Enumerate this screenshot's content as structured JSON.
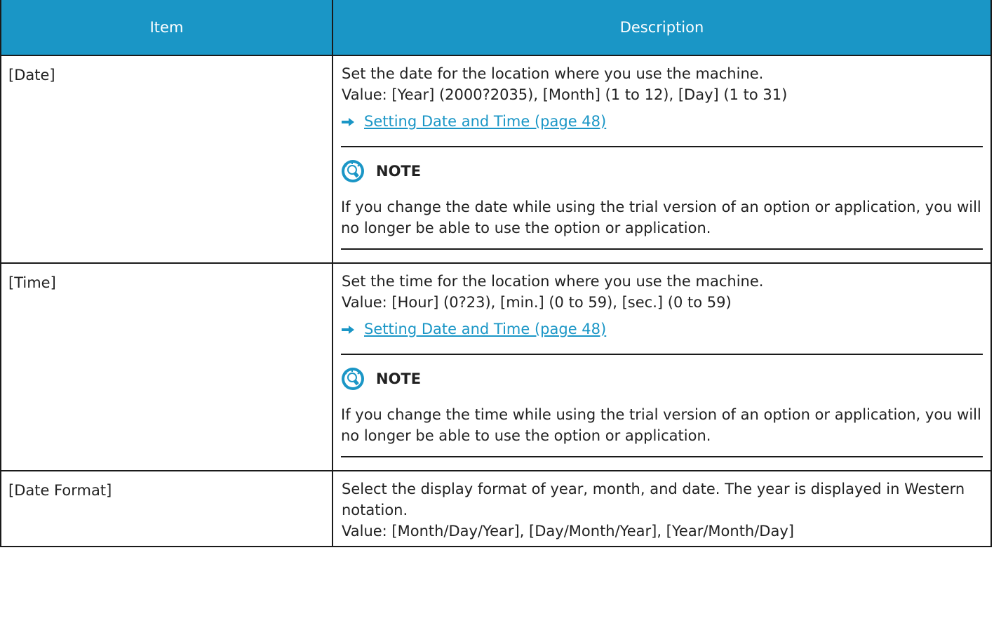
{
  "header": {
    "col_item": "Item",
    "col_desc": "Description"
  },
  "rows": [
    {
      "item": "[Date]",
      "line1": "Set the date for the location where you use the machine.",
      "line2": "Value: [Year] (2000?2035),  [Month] (1 to 12), [Day] (1 to 31)",
      "link": "Setting Date and Time (page 48)",
      "note_title": "NOTE",
      "note_body": "If you change the date while using the trial version of an option or application, you will no longer be able to use the option or application."
    },
    {
      "item": "[Time]",
      "line1": "Set the time for the location where you use the machine.",
      "line2": "Value: [Hour] (0?23),  [min.] (0 to 59), [sec.] (0 to 59)",
      "link": "Setting Date and Time (page 48)",
      "note_title": "NOTE",
      "note_body": "If you change the time while using the trial version of an option or application, you will no longer be able to use the option or application."
    },
    {
      "item": "[Date Format]",
      "line1": "Select the display format of year, month, and date. The year is displayed in Western notation.",
      "line2": "Value: [Month/Day/Year], [Day/Month/Year], [Year/Month/Day]"
    }
  ],
  "colors": {
    "header_bg": "#1a96c6",
    "link": "#1a96c6",
    "border": "#1a1a1a"
  },
  "icons": {
    "arrow": "right-arrow-icon",
    "note": "lightbulb-note-icon"
  }
}
